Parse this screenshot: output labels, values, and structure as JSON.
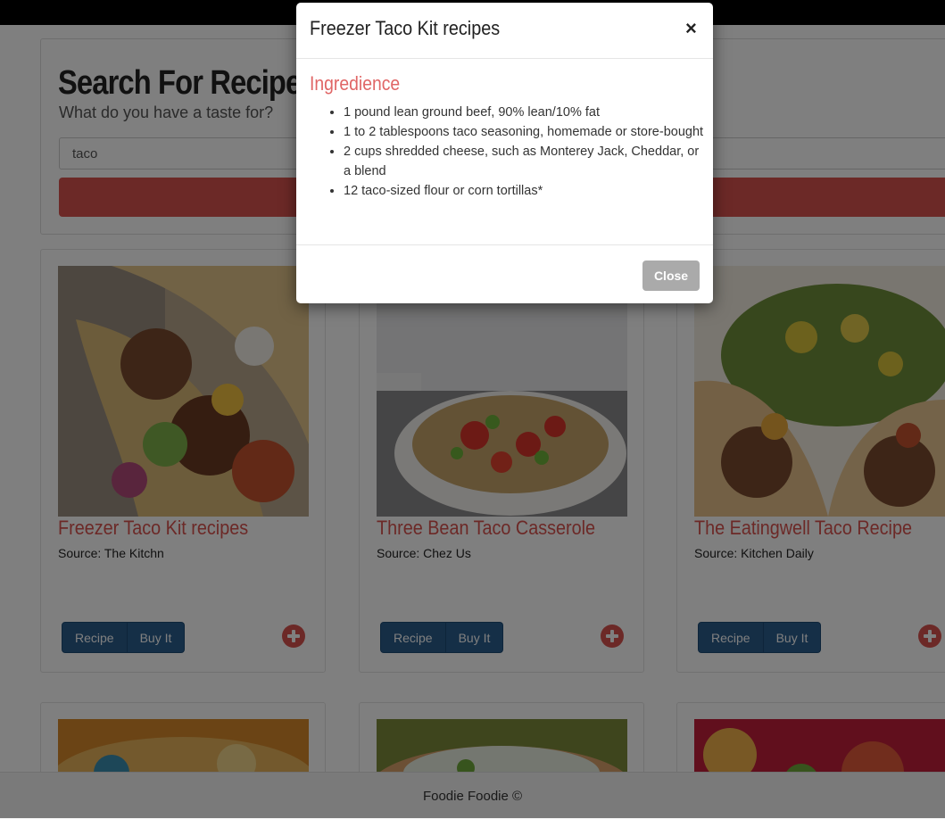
{
  "search": {
    "title": "Search For Recipe",
    "subtitle": "What do you have a taste for?",
    "query": "taco"
  },
  "recipes": [
    {
      "title": "Freezer Taco Kit recipes",
      "source": "Source: The Kitchn",
      "recipe_label": "Recipe",
      "buy_label": "Buy It"
    },
    {
      "title": "Three Bean Taco Casserole",
      "source": "Source: Chez Us",
      "recipe_label": "Recipe",
      "buy_label": "Buy It"
    },
    {
      "title": "The Eatingwell Taco Recipe",
      "source": "Source: Kitchen Daily",
      "recipe_label": "Recipe",
      "buy_label": "Buy It"
    }
  ],
  "footer": {
    "text": "Foodie Foodie ©"
  },
  "modal": {
    "title": "Freezer Taco Kit recipes",
    "close_x": "×",
    "ingredients_heading": "Ingredience",
    "ingredients": [
      "1 pound lean ground beef, 90% lean/10% fat",
      "1 to 2 tablespoons taco seasoning, homemade or store-bought",
      "2 cups shredded cheese, such as Monterey Jack, Cheddar, or a blend",
      "12 taco-sized flour or corn tortillas*"
    ],
    "close_label": "Close"
  },
  "colors": {
    "accent": "#d9534f",
    "button_primary": "#2b5f8f",
    "heading_red": "#e06666"
  },
  "icons": {
    "add": "plus-circle-icon",
    "close": "close-icon"
  }
}
